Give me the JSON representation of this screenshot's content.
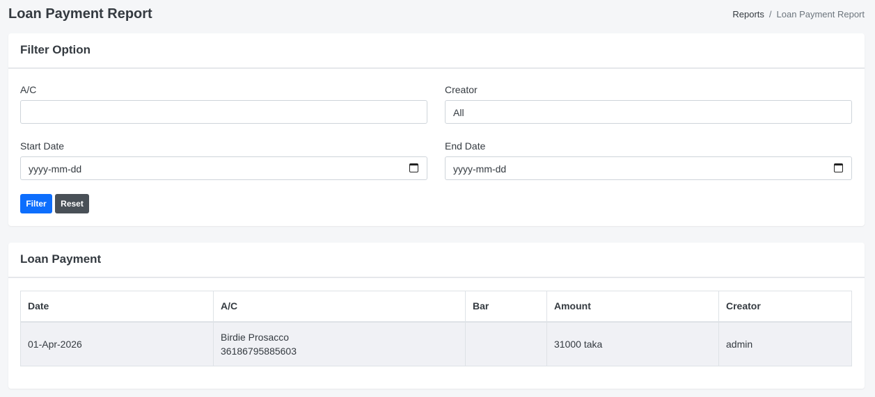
{
  "header": {
    "title": "Loan Payment Report",
    "breadcrumb": {
      "parent": "Reports",
      "separator": "/",
      "current": "Loan Payment Report"
    }
  },
  "filter": {
    "title": "Filter Option",
    "ac_label": "A/C",
    "ac_value": "",
    "creator_label": "Creator",
    "creator_value": "All",
    "start_date_label": "Start Date",
    "start_date_value": "yyyy-mm-dd",
    "end_date_label": "End Date",
    "end_date_value": "yyyy-mm-dd",
    "filter_button": "Filter",
    "reset_button": "Reset"
  },
  "loan_payment": {
    "title": "Loan Payment",
    "columns": [
      "Date",
      "A/C",
      "Bar",
      "Amount",
      "Creator"
    ],
    "rows": [
      {
        "date": "01-Apr-2026",
        "ac_name": "Birdie Prosacco",
        "ac_number": "36186795885603",
        "bar": "",
        "amount": "31000 taka",
        "creator": "admin"
      }
    ]
  },
  "colors": {
    "primary": "#0d6efd",
    "secondary": "#495057",
    "background": "#f5f6f8"
  }
}
